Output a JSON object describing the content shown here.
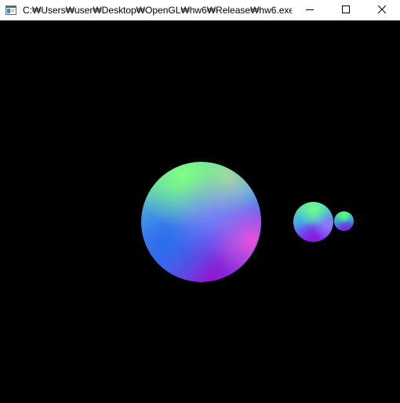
{
  "window": {
    "title": "C:₩Users₩user₩Desktop₩OpenGL₩hw6₩Release₩hw6.exe",
    "icon": "console-app-icon",
    "controls": {
      "minimize_icon": "minimize-icon",
      "maximize_icon": "maximize-icon",
      "close_icon": "close-icon"
    }
  },
  "scene": {
    "background": "#000000",
    "objects": [
      {
        "name": "large-sphere",
        "colors": [
          "#5ff08a",
          "#5560f0",
          "#f050dc",
          "#9614d2"
        ]
      },
      {
        "name": "medium-sphere",
        "colors": [
          "#55f09a",
          "#5f5ef0",
          "#8a32d8"
        ]
      },
      {
        "name": "small-sphere",
        "colors": [
          "#50f07a",
          "#5a55e8",
          "#7a30d0"
        ]
      }
    ]
  }
}
